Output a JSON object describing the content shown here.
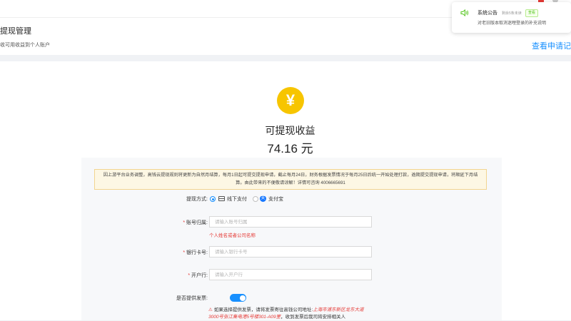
{
  "header": {
    "title": "提现管理",
    "desc": "收可用收益到个人账户",
    "view_link": "查看申请记"
  },
  "summary": {
    "currency_symbol": "¥",
    "label": "可提现收益",
    "amount": "74.16 元"
  },
  "notice": "因上游平台业务调整，高钱云提现规则将更新为自然月结算，每月1日起可提交提现申请，截止每月24日，财务根据发票情况于每月25日后统一开始处理打款，逾期提交提现申请，将顺延下月结算。由此带来的不便敬请谅解！详情可咨询 4006665691",
  "form": {
    "method": {
      "label": "提现方式:",
      "options": [
        {
          "label": "线下支付",
          "selected": true
        },
        {
          "label": "支付宝",
          "selected": false
        }
      ]
    },
    "account": {
      "label": "账号归属:",
      "placeholder": "请输入账号归属",
      "error": "个人姓名或者公司名称"
    },
    "bank_card": {
      "label": "银行卡号:",
      "placeholder": "请输入银行卡号"
    },
    "bank_branch": {
      "label": "开户行:",
      "placeholder": "请输入开户行"
    },
    "invoice": {
      "label": "是否提供发票:",
      "enabled": true,
      "warning_prefix": "如果选择提供发票，请将发票寄往高钱公司地址:",
      "warning_address": "上海市浦东新区龙东大道3000号张江集电港5号楼301-A09室",
      "warning_suffix": "，收到发票后我司将安排相关人"
    }
  },
  "toast": {
    "title": "系统公告",
    "sub": "剩余5条未读",
    "tag": "查看",
    "body": "对老旧版本取消迷哩登录的补充说明"
  },
  "colors": {
    "primary": "#1890ff",
    "error": "#e53935",
    "badge": "#f7c500",
    "notice_bg": "#fdf7e4",
    "success": "#52c41a"
  },
  "icons": {
    "speaker": "speaker-icon",
    "yuan": "yuan-icon",
    "card": "card-icon",
    "alipay": "alipay-icon",
    "warning": "warning-icon"
  }
}
